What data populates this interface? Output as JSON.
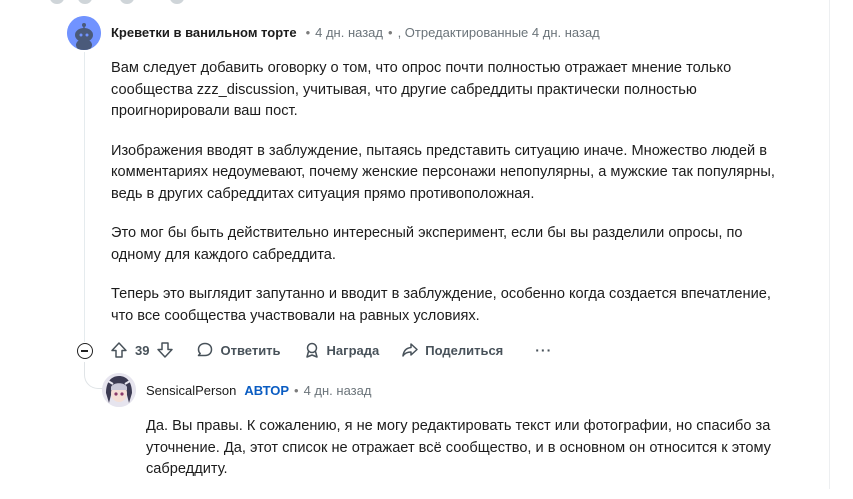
{
  "comment1": {
    "author": "Креветки в ванильном торте",
    "separator": "•",
    "time": "4 дн. назад",
    "edited": ", Отредактированные 4 дн. назад",
    "paragraphs": [
      "Вам следует добавить оговорку о том, что опрос почти полностью отражает мнение только сообщества zzz_discussion, учитывая, что другие сабреддиты практически полностью проигнорировали ваш пост.",
      "Изображения вводят в заблуждение, пытаясь представить ситуацию иначе. Множество людей в комментариях недоумевают, почему женские персонажи непопулярны, а мужские так популярны, ведь в других сабреддитах ситуация прямо противоположная.",
      "Это мог бы быть действительно интересный эксперимент, если бы вы разделили опросы, по одному для каждого сабреддита.",
      "Теперь это выглядит запутанно и вводит в заблуждение, особенно когда создается впечатление, что все сообщества участвовали на равных условиях."
    ],
    "votes": "39",
    "reply_label": "Ответить",
    "award_label": "Награда",
    "share_label": "Поделиться",
    "more_label": "···"
  },
  "comment2": {
    "author": "SensicalPerson",
    "op_badge": "АВТОР",
    "separator": "•",
    "time": "4 дн. назад",
    "text": "Да. Вы правы. К сожалению, я не могу редактировать текст или фотографии, но спасибо за уточнение. Да, этот список не отражает всё сообщество, и в основном он относится к этому сабреддиту."
  },
  "colors": {
    "accent_blue": "#0a5cc2",
    "avatar_bg": "#7193ff"
  }
}
